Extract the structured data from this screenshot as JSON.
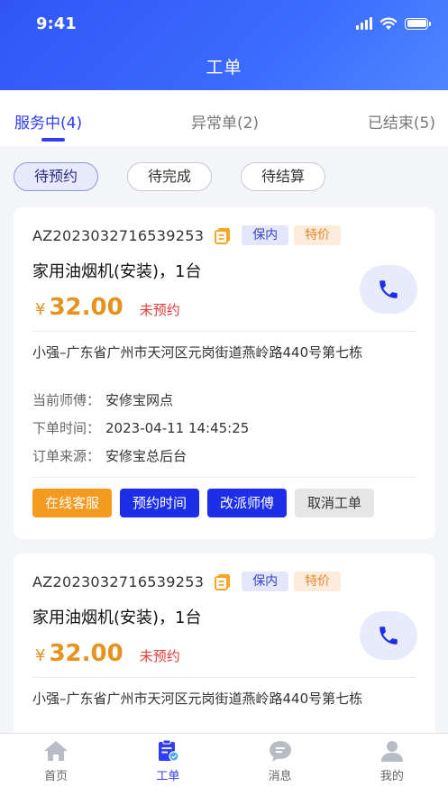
{
  "status_bar": {
    "time": "9:41"
  },
  "header": {
    "title": "工单"
  },
  "tabs": [
    {
      "label": "服务中(4)",
      "active": true
    },
    {
      "label": "异常单(2)",
      "active": false
    },
    {
      "label": "已结束(5)",
      "active": false
    }
  ],
  "filters": [
    {
      "label": "待预约",
      "active": true
    },
    {
      "label": "待完成",
      "active": false
    },
    {
      "label": "待结算",
      "active": false
    }
  ],
  "orders": [
    {
      "order_no": "AZ2023032716539253",
      "tags": [
        "保内",
        "特价"
      ],
      "product": "家用油烟机(安装)，1台",
      "currency": "¥",
      "price": "32.00",
      "status": "未预约",
      "address": "小强–广东省广州市天河区元岗街道燕岭路440号第七栋",
      "technician_label": "当前师傅：",
      "technician": "安修宝网点",
      "time_label": "下单时间：",
      "order_time": "2023-04-11 14:45:25",
      "source_label": "订单来源：",
      "source": "安修宝总后台",
      "actions": [
        "在线客服",
        "预约时间",
        "改派师傅",
        "取消工单"
      ]
    },
    {
      "order_no": "AZ2023032716539253",
      "tags": [
        "保内",
        "特价"
      ],
      "product": "家用油烟机(安装)，1台",
      "currency": "¥",
      "price": "32.00",
      "status": "未预约",
      "address": "小强–广东省广州市天河区元岗街道燕岭路440号第七栋"
    }
  ],
  "bottom_nav": [
    {
      "label": "首页",
      "icon": "home-icon",
      "active": false
    },
    {
      "label": "工单",
      "icon": "work-order-icon",
      "active": true
    },
    {
      "label": "消息",
      "icon": "message-icon",
      "active": false
    },
    {
      "label": "我的",
      "icon": "profile-icon",
      "active": false
    }
  ],
  "colors": {
    "primary": "#2f3ff0",
    "accent_orange": "#e5931e",
    "danger": "#e23b3b"
  }
}
